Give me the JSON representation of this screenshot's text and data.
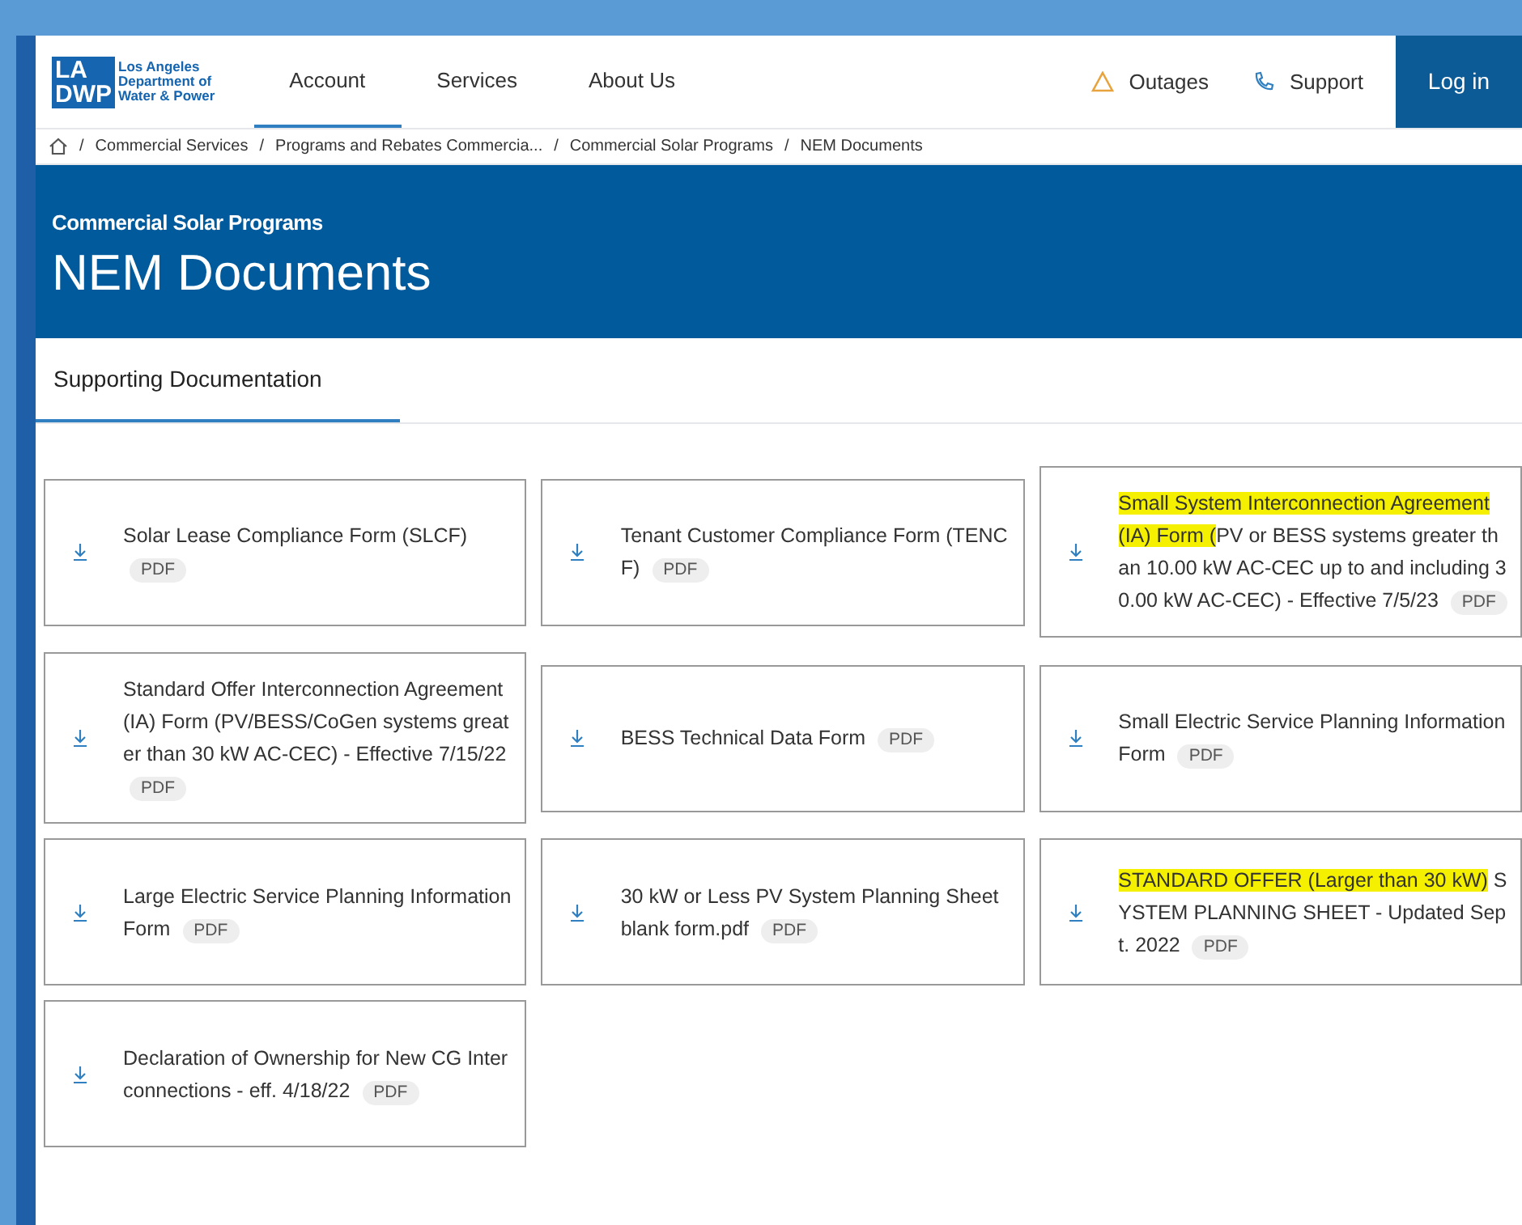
{
  "logo": {
    "mark_top": "LA",
    "mark_bottom": "DWP",
    "org_lines": [
      "Los Angeles",
      "Department of",
      "Water & Power"
    ]
  },
  "nav": [
    {
      "label": "Account",
      "selected": true
    },
    {
      "label": "Services",
      "selected": false
    },
    {
      "label": "About Us",
      "selected": false
    }
  ],
  "utility_links": [
    {
      "label": "Outages",
      "kind": "warning"
    },
    {
      "label": "Support",
      "kind": "phone"
    }
  ],
  "login_button": "Log in",
  "breadcrumbs": [
    {
      "separator": "/",
      "label": "Commercial Services"
    },
    {
      "separator": "/",
      "label": "Programs and Rebates Commercia..."
    },
    {
      "separator": "/",
      "label": "Commercial Solar Programs"
    },
    {
      "separator": "/",
      "label": "NEM Documents"
    }
  ],
  "banner": {
    "eyebrow": "Commercial Solar Programs",
    "title": "NEM Documents"
  },
  "tabs": [
    {
      "label": "Supporting Documentation",
      "selected": true
    }
  ],
  "documents": [
    {
      "title": "Solar Lease Compliance Form (SLCF)",
      "badge": "PDF"
    },
    {
      "title": "Tenant Customer Compliance Form (TENCF)",
      "badge": "PDF"
    },
    {
      "highlight": "Small System Interconnection Agreement (IA) Form (",
      "title": "PV or BESS systems greater than 10.00 kW AC-CEC up to and including 30.00 kW AC-CEC) - Effective 7/5/23",
      "badge": "PDF"
    },
    {
      "title": "Standard Offer Interconnection Agreement (IA) Form (PV/BESS/CoGen systems greater than 30 kW AC-CEC) - Effective 7/15/22",
      "badge": "PDF"
    },
    {
      "title": "BESS Technical Data Form",
      "badge": "PDF"
    },
    {
      "title": "Small Electric Service Planning Information Form",
      "badge": "PDF"
    },
    {
      "title": "Large Electric Service Planning Information Form",
      "badge": "PDF"
    },
    {
      "title": "30 kW or Less PV System Planning Sheet blank form.pdf",
      "badge": "PDF"
    },
    {
      "highlight": "STANDARD OFFER (Larger than 30 kW)",
      "title": " SYSTEM PLANNING SHEET - Updated Sept. 2022",
      "badge": "PDF"
    },
    {
      "title": "Declaration of Ownership for New CG Interconnections - eff. 4/18/22",
      "badge": "PDF"
    }
  ]
}
